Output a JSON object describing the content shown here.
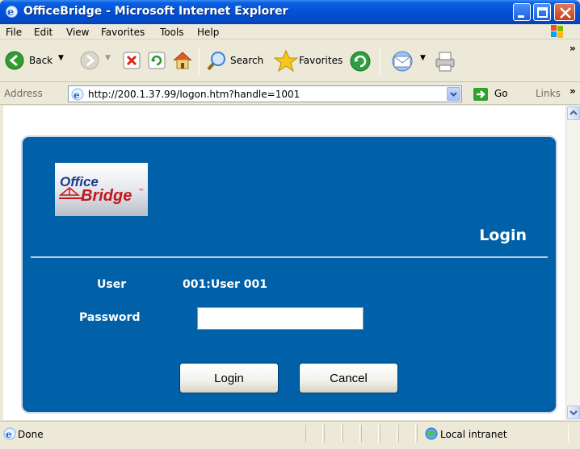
{
  "window": {
    "title": "OfficeBridge - Microsoft Internet Explorer",
    "colors": {
      "titlebar": "#0351d8",
      "close": "#c5401d"
    }
  },
  "menu": {
    "items": [
      "File",
      "Edit",
      "View",
      "Favorites",
      "Tools",
      "Help"
    ]
  },
  "toolbar": {
    "back_label": "Back",
    "search_label": "Search",
    "favorites_label": "Favorites"
  },
  "address": {
    "label": "Address",
    "url": "http://200.1.37.99/logon.htm?handle=1001",
    "go_label": "Go",
    "links_label": "Links"
  },
  "page": {
    "logo_line1": "Office",
    "logo_line2": "Bridge",
    "logo_mark": "™",
    "heading": "Login",
    "user_label": "User",
    "user_value": "001:User 001",
    "password_label": "Password",
    "password_value": "",
    "login_button": "Login",
    "cancel_button": "Cancel",
    "colors": {
      "panel": "#0060a8"
    }
  },
  "status": {
    "text": "Done",
    "zone": "Local intranet"
  }
}
